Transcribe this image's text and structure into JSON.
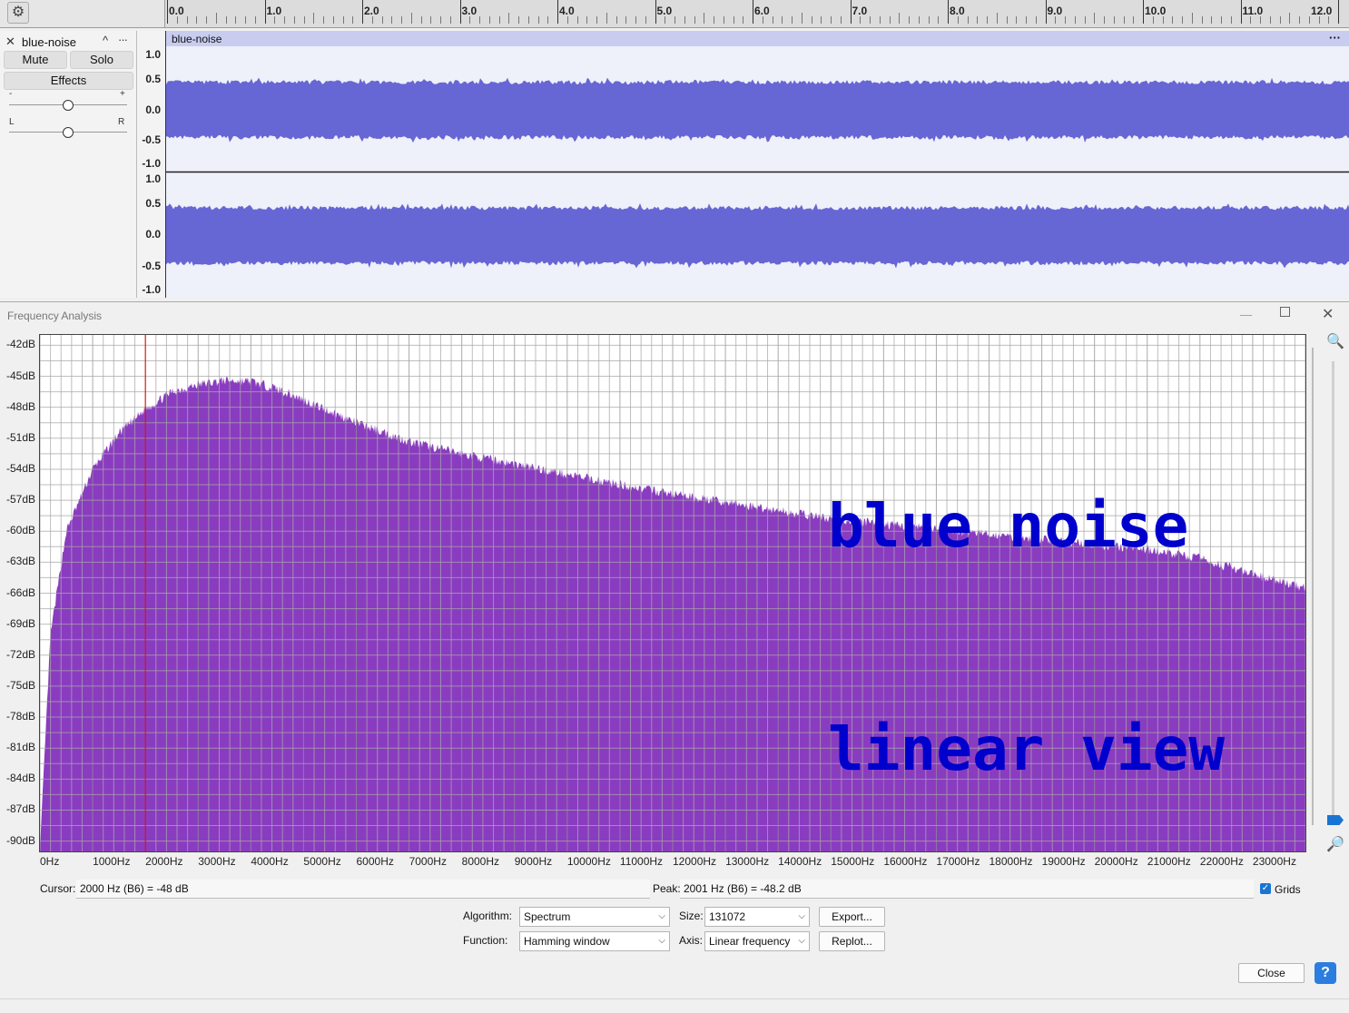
{
  "timeline": {
    "ticks": [
      "0.0",
      "1.0",
      "2.0",
      "3.0",
      "4.0",
      "5.0",
      "6.0",
      "7.0",
      "8.0",
      "9.0",
      "10.0",
      "11.0",
      "12.0"
    ]
  },
  "track": {
    "name": "blue-noise",
    "clip_name": "blue-noise",
    "mute_label": "Mute",
    "solo_label": "Solo",
    "effects_label": "Effects",
    "gain_minus": "-",
    "gain_plus": "+",
    "pan_left": "L",
    "pan_right": "R",
    "amplitude_labels": [
      "1.0",
      "0.5",
      "0.0",
      "-0.5",
      "-1.0"
    ],
    "menu_glyph": "···",
    "waveform_color": "#6666d4"
  },
  "dialog": {
    "title": "Frequency Analysis",
    "overlay_text_line1": "blue noise",
    "overlay_text_line2": "linear view",
    "overlay_color": "#0000cc",
    "spectrum_color": "#8a3cc0",
    "cursor_line_hz": 2000,
    "cursor_label": "Cursor:",
    "cursor_value": "2000 Hz (B6) = -48 dB",
    "peak_label": "Peak:",
    "peak_value": "2001 Hz (B6) = -48.2 dB",
    "grids_label": "Grids",
    "grids_checked": true,
    "algorithm_label": "Algorithm:",
    "algorithm_value": "Spectrum",
    "size_label": "Size:",
    "size_value": "131072",
    "function_label": "Function:",
    "function_value": "Hamming window",
    "axis_label": "Axis:",
    "axis_value": "Linear frequency",
    "export_label": "Export...",
    "replot_label": "Replot...",
    "close_label": "Close",
    "help_label": "?"
  },
  "chart_data": {
    "type": "area",
    "title": "",
    "xlabel": "",
    "ylabel": "",
    "x_tick_labels": [
      "0Hz",
      "1000Hz",
      "2000Hz",
      "3000Hz",
      "4000Hz",
      "5000Hz",
      "6000Hz",
      "7000Hz",
      "8000Hz",
      "9000Hz",
      "10000Hz",
      "11000Hz",
      "12000Hz",
      "13000Hz",
      "14000Hz",
      "15000Hz",
      "16000Hz",
      "17000Hz",
      "18000Hz",
      "19000Hz",
      "20000Hz",
      "21000Hz",
      "22000Hz",
      "23000Hz"
    ],
    "y_tick_labels": [
      "-42dB",
      "-45dB",
      "-48dB",
      "-51dB",
      "-54dB",
      "-57dB",
      "-60dB",
      "-63dB",
      "-66dB",
      "-69dB",
      "-72dB",
      "-75dB",
      "-78dB",
      "-81dB",
      "-84dB",
      "-87dB",
      "-90dB"
    ],
    "xlim": [
      0,
      24000
    ],
    "ylim": [
      -91,
      -41
    ],
    "grid": true,
    "series": [
      {
        "x": [
          0,
          200,
          500,
          1000,
          1500,
          2000,
          2500,
          3000,
          3500,
          4000,
          4500,
          5000,
          6000,
          7000,
          8000,
          9000,
          10000,
          11000,
          12000,
          13000,
          14000,
          15000,
          16000,
          17000,
          18000,
          19000,
          20000,
          21000,
          22000,
          23000,
          24000
        ],
        "values": [
          -91,
          -70,
          -60,
          -54,
          -50.5,
          -48.2,
          -46.5,
          -45.8,
          -45.4,
          -45.5,
          -46.2,
          -47.3,
          -49.5,
          -51.3,
          -52.5,
          -53.5,
          -54.5,
          -55.5,
          -56.4,
          -57.2,
          -58,
          -58.8,
          -59.3,
          -59.8,
          -60.3,
          -60.8,
          -61.3,
          -61.8,
          -62.6,
          -64.2,
          -65.5
        ]
      }
    ]
  }
}
